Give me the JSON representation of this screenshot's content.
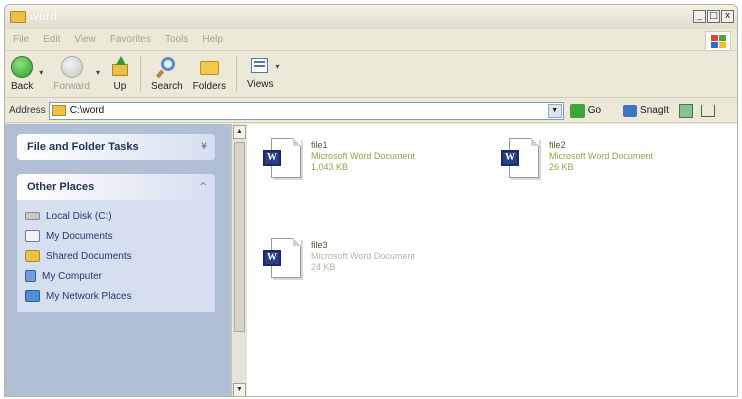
{
  "window": {
    "title": "word",
    "buttons": [
      "_",
      "□",
      "x"
    ]
  },
  "menubar": {
    "items": [
      "File",
      "Edit",
      "View",
      "Favorites",
      "Tools",
      "Help"
    ]
  },
  "toolbar": {
    "back": "Back",
    "forward": "Forward",
    "up": "Up",
    "search": "Search",
    "folders": "Folders",
    "views": "Views"
  },
  "address": {
    "label": "Address",
    "value": "C:\\word",
    "go": "Go",
    "snagit": "SnagIt"
  },
  "taskpane": {
    "file_tasks": "File and Folder Tasks",
    "other_places": "Other Places",
    "places": [
      "Local Disk (C:)",
      "My Documents",
      "Shared Documents",
      "My Computer",
      "My Network Places"
    ]
  },
  "files": [
    {
      "name": "file1",
      "type": "Microsoft Word Document",
      "size": "1,043 KB"
    },
    {
      "name": "file2",
      "type": "Microsoft Word Document",
      "size": "26 KB"
    },
    {
      "name": "file3",
      "type": "Microsoft Word Document",
      "size": "24 KB"
    }
  ],
  "colors": {
    "taskpane_bg": "#b1bfd5",
    "panel_title": "#20335c",
    "link_text": "#21396e",
    "word_blue": "#263f88"
  }
}
